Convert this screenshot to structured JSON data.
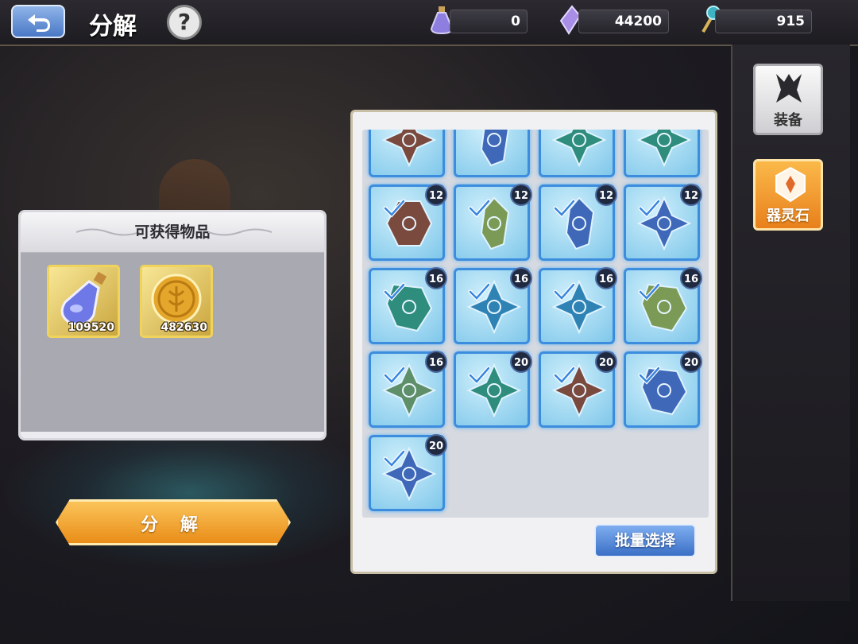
{
  "header": {
    "title": "分解",
    "help_symbol": "?"
  },
  "resources": [
    {
      "icon": "purple-potion-icon",
      "value": "0"
    },
    {
      "icon": "crystal-icon",
      "value": "44200"
    },
    {
      "icon": "gem-staff-icon",
      "value": "915"
    }
  ],
  "reward_panel": {
    "title": "可获得物品",
    "items": [
      {
        "icon": "blue-potion-icon",
        "count": "109520"
      },
      {
        "icon": "gold-coin-icon",
        "count": "482630"
      }
    ]
  },
  "decompose_button": {
    "label": "分 解"
  },
  "batch_select_button": {
    "label": "批量选择"
  },
  "side_tabs": [
    {
      "label": "装备",
      "icon": "equipment-icon",
      "active": false
    },
    {
      "label": "器灵石",
      "icon": "spirit-stone-icon",
      "active": true
    }
  ],
  "items": [
    {
      "shape": "star",
      "color": "#7a4a3e",
      "level": "",
      "checked": false
    },
    {
      "shape": "crystal",
      "color": "#3f68b8",
      "level": "",
      "checked": false
    },
    {
      "shape": "star",
      "color": "#2e8d7c",
      "level": "",
      "checked": false
    },
    {
      "shape": "star",
      "color": "#2e8d7c",
      "level": "",
      "checked": false
    },
    {
      "shape": "hex",
      "color": "#7a4a3e",
      "level": "12",
      "checked": true
    },
    {
      "shape": "crystal",
      "color": "#7a9a55",
      "level": "12",
      "checked": true
    },
    {
      "shape": "crystal",
      "color": "#3f68b8",
      "level": "12",
      "checked": true
    },
    {
      "shape": "star",
      "color": "#3f68b8",
      "level": "12",
      "checked": true
    },
    {
      "shape": "shard",
      "color": "#2e8d7c",
      "level": "16",
      "checked": true
    },
    {
      "shape": "star",
      "color": "#2f83b4",
      "level": "16",
      "checked": true
    },
    {
      "shape": "star",
      "color": "#2f83b4",
      "level": "16",
      "checked": true
    },
    {
      "shape": "shard",
      "color": "#7a9a55",
      "level": "16",
      "checked": true
    },
    {
      "shape": "star",
      "color": "#5e8f68",
      "level": "16",
      "checked": true
    },
    {
      "shape": "star",
      "color": "#2e8d7c",
      "level": "20",
      "checked": true
    },
    {
      "shape": "star",
      "color": "#7a4a3e",
      "level": "20",
      "checked": true
    },
    {
      "shape": "shard",
      "color": "#3f68b8",
      "level": "20",
      "checked": true
    },
    {
      "shape": "star",
      "color": "#3f68b8",
      "level": "20",
      "checked": true
    }
  ],
  "colors": {
    "accent_orange": "#e98d18",
    "accent_blue": "#3b6fc6",
    "slot_border": "#3d8dde"
  }
}
